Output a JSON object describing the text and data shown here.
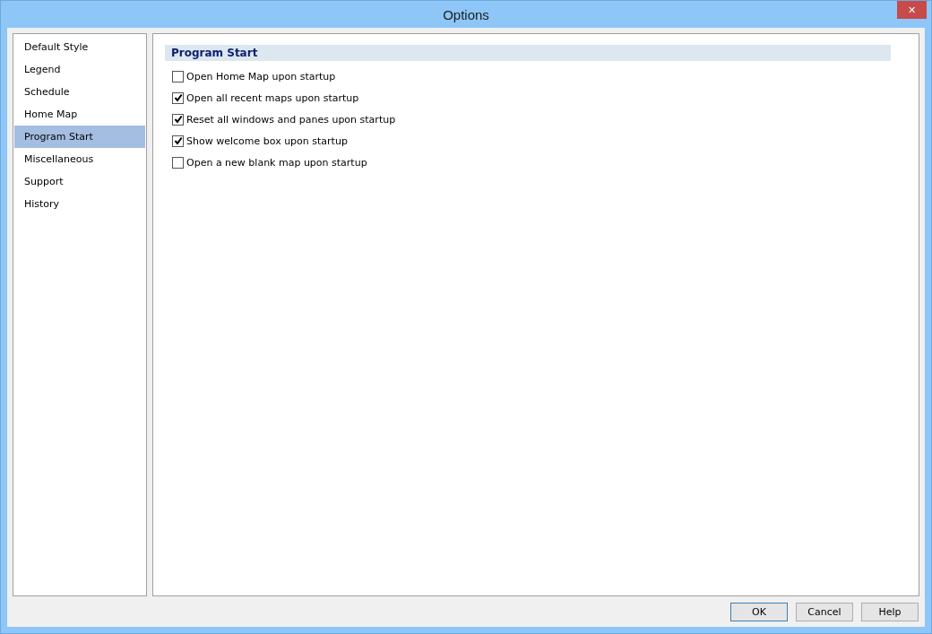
{
  "window": {
    "title": "Options",
    "close": "✕"
  },
  "sidebar": {
    "items": [
      {
        "label": "Default Style",
        "selected": false
      },
      {
        "label": "Legend",
        "selected": false
      },
      {
        "label": "Schedule",
        "selected": false
      },
      {
        "label": "Home Map",
        "selected": false
      },
      {
        "label": "Program Start",
        "selected": true
      },
      {
        "label": "Miscellaneous",
        "selected": false
      },
      {
        "label": "Support",
        "selected": false
      },
      {
        "label": "History",
        "selected": false
      }
    ]
  },
  "section": {
    "title": "Program Start",
    "options": [
      {
        "label": "Open Home Map upon startup",
        "checked": false
      },
      {
        "label": "Open all recent maps upon startup",
        "checked": true
      },
      {
        "label": "Reset all windows and panes upon startup",
        "checked": true
      },
      {
        "label": "Show welcome box upon startup",
        "checked": true
      },
      {
        "label": "Open a new blank map upon startup",
        "checked": false
      }
    ]
  },
  "buttons": [
    {
      "label": "OK",
      "default": true
    },
    {
      "label": "Cancel",
      "default": false
    },
    {
      "label": "Help",
      "default": false
    }
  ]
}
